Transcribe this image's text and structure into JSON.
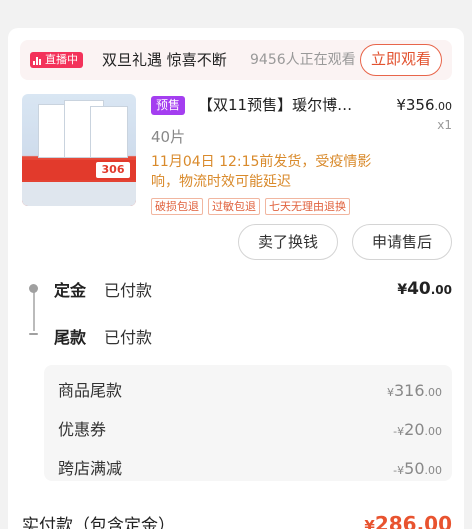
{
  "live": {
    "badge": "直播中",
    "title": "双旦礼遇 惊喜不断",
    "viewers": "9456人正在观看",
    "watch_button": "立即观看"
  },
  "product": {
    "image_icon": "product-photo",
    "image_price": "306",
    "tag": "预售",
    "title": "【双11预售】瑗尔博…",
    "price_currency": "¥",
    "price_int": "356",
    "price_dec": ".00",
    "quantity": "x1",
    "spec": "40片",
    "shipping_note": "11月04日 12:15前发货，受疫情影响，物流时效可能延迟",
    "service_tags": [
      "破损包退",
      "过敏包退",
      "七天无理由退换"
    ]
  },
  "actions": {
    "sell_label": "卖了换钱",
    "aftersale_label": "申请售后"
  },
  "payment": {
    "deposit_label": "定金",
    "deposit_status": "已付款",
    "deposit_currency": "¥",
    "deposit_int": "40",
    "deposit_dec": ".00",
    "balance_label": "尾款",
    "balance_status": "已付款"
  },
  "details": [
    {
      "label": "商品尾款",
      "prefix": "¥",
      "int": "316",
      "dec": ".00"
    },
    {
      "label": "优惠券",
      "prefix": "-¥",
      "int": "20",
      "dec": ".00"
    },
    {
      "label": "跨店满减",
      "prefix": "-¥",
      "int": "50",
      "dec": ".00"
    }
  ],
  "total": {
    "label": "实付款（包含定金）",
    "currency": "¥",
    "int": "286",
    "dec": ".00"
  },
  "colors": {
    "live_badge": "#f3325a",
    "accent": "#e8532f",
    "presale_tag": "#a43ef0",
    "shipping_note": "#d98a2b"
  }
}
